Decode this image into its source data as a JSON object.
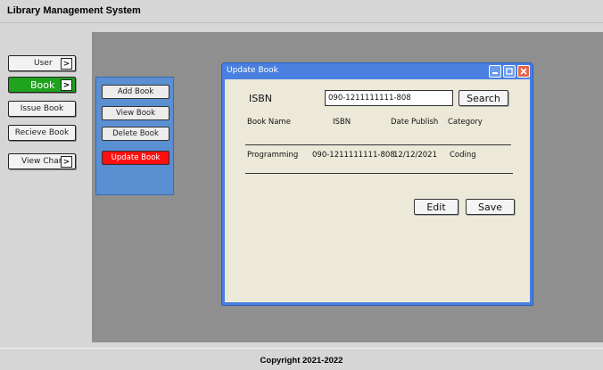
{
  "app": {
    "title": "Library Management System"
  },
  "nav": {
    "user_label": "User",
    "book_label": "Book",
    "issue_label": "Issue Book",
    "recieve_label": "Recieve Book",
    "chart_label": "View Chart",
    "arrow": ">"
  },
  "book_menu": {
    "add": "Add Book",
    "view": "View Book",
    "delete": "Delete Book",
    "update": "Update Book"
  },
  "dialog": {
    "title": "Update Book",
    "isbn_label": "ISBN",
    "isbn_value": "090-1211111111-808",
    "search_label": "Search",
    "columns": [
      "Book Name",
      "ISBN",
      "Date Publish",
      "Category"
    ],
    "row": [
      "Programming",
      "090-1211111111-808",
      "12/12/2021",
      "Coding"
    ],
    "edit_label": "Edit",
    "save_label": "Save"
  },
  "footer": {
    "text": "Copyright 2021-2022"
  },
  "colors": {
    "active_nav": "#1fa31f",
    "active_menu": "#ff1010",
    "window_frame": "#4a7fe0",
    "window_body": "#ece9d8"
  }
}
